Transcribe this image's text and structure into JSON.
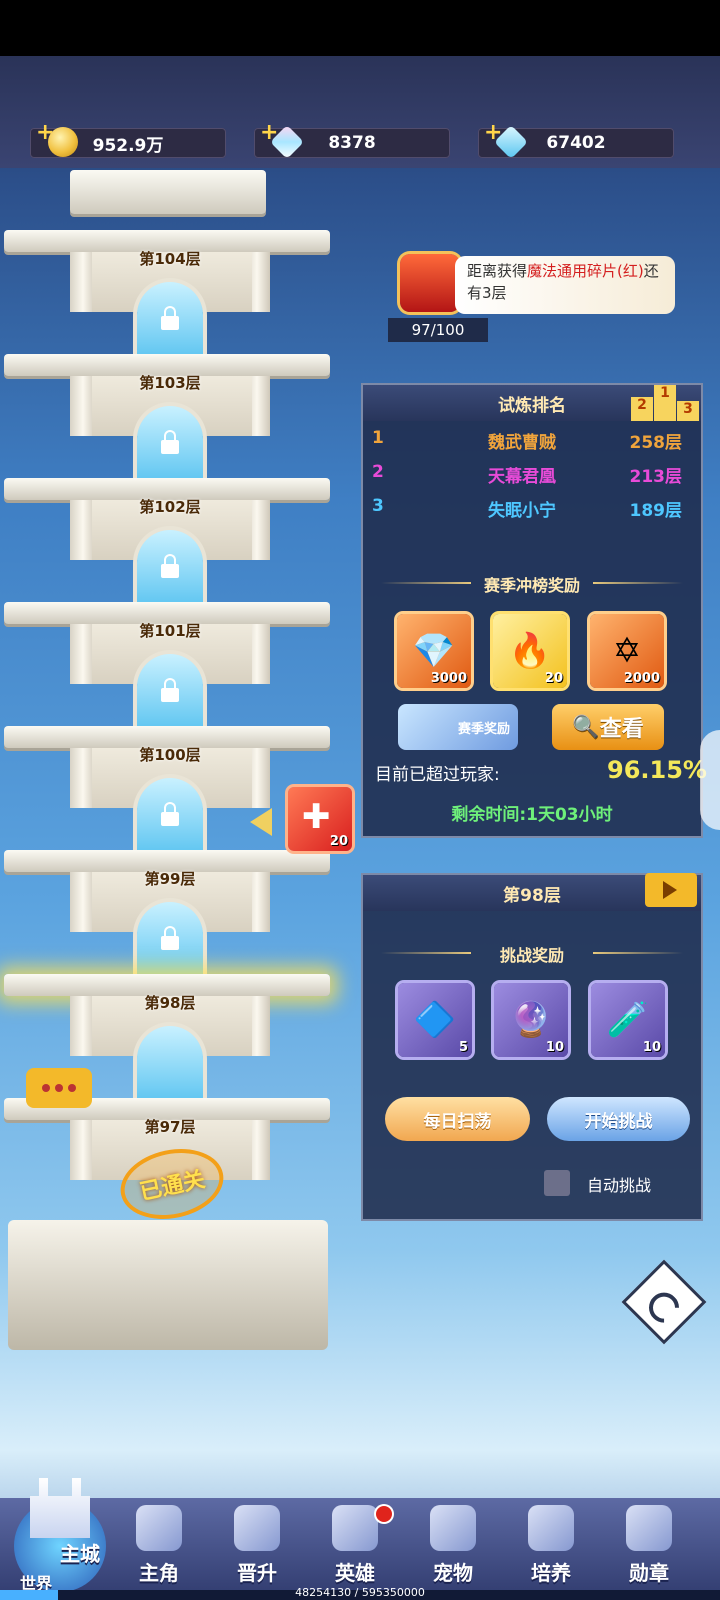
{
  "resources": [
    {
      "name": "gold",
      "value": "952.9万"
    },
    {
      "name": "crystal",
      "value": "8378"
    },
    {
      "name": "diamond",
      "value": "67402"
    }
  ],
  "tower": {
    "floors": [
      "第104层",
      "第103层",
      "第102层",
      "第101层",
      "第100层",
      "第99层",
      "第98层",
      "第97层"
    ],
    "current_floor_index": 6,
    "cleared_label": "已通关",
    "puzzle_reward_count": "20"
  },
  "chest": {
    "text_prefix": "距离获得",
    "text_red": "魔法通用碎片(红)",
    "text_suffix": "还有3层",
    "progress": "97/100"
  },
  "ranking": {
    "title": "试炼排名",
    "podium": [
      "2",
      "1",
      "3"
    ],
    "rows": [
      {
        "rank": "1",
        "name": "魏武曹贼",
        "floor": "258层",
        "color": "#f0a43c"
      },
      {
        "rank": "2",
        "name": "天幕君凰",
        "floor": "213层",
        "color": "#e84bd8"
      },
      {
        "rank": "3",
        "name": "失眠小宁",
        "floor": "189层",
        "color": "#4ec7ff"
      }
    ],
    "season_title": "赛季冲榜奖励",
    "season_rewards": [
      {
        "icon": "diamond-icon",
        "count": "3000"
      },
      {
        "icon": "fire-icon",
        "count": "20"
      },
      {
        "icon": "star-emblem-icon",
        "count": "2000"
      }
    ],
    "season_button": "赛季奖励",
    "view_button": "查看",
    "surpass_label": "目前已超过玩家:",
    "surpass_pct": "96.15%",
    "remaining": "剩余时间:1天03小时"
  },
  "floor_panel": {
    "title": "第98层",
    "rewards_title": "挑战奖励",
    "rewards": [
      {
        "icon": "exp-crystal-icon",
        "count": "5"
      },
      {
        "icon": "crystal-ball-icon",
        "count": "10"
      },
      {
        "icon": "potion-icon",
        "count": "10"
      }
    ],
    "sweep_button": "每日扫荡",
    "start_button": "开始挑战",
    "auto_label": "自动挑战"
  },
  "nav": {
    "city_main": "主城",
    "city_world": "世界",
    "items": [
      "主角",
      "晋升",
      "英雄",
      "宠物",
      "培养",
      "勋章"
    ]
  },
  "exp": {
    "text": "48254130 / 595350000",
    "fraction": 0.081
  }
}
